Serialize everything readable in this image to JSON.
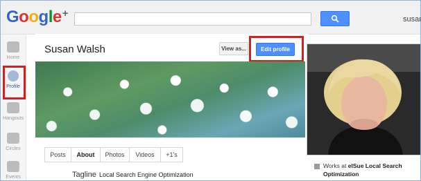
{
  "header": {
    "logo_parts": [
      "G",
      "o",
      "o",
      "g",
      "l",
      "e"
    ],
    "logo_plus": "+",
    "search_placeholder": "",
    "user_name": "susan"
  },
  "leftnav": {
    "items": [
      {
        "label": "Home",
        "icon": "home-icon"
      },
      {
        "label": "Profile",
        "icon": "profile-icon"
      },
      {
        "label": "Hangouts",
        "icon": "hangouts-icon"
      },
      {
        "label": "Circles",
        "icon": "circles-icon"
      },
      {
        "label": "Events",
        "icon": "events-icon"
      }
    ]
  },
  "profile": {
    "name": "Susan Walsh",
    "view_as_label": "View as...",
    "edit_profile_label": "Edit profile",
    "tabs": [
      "Posts",
      "About",
      "Photos",
      "Videos",
      "+1's"
    ],
    "active_tab": "About",
    "tagline_label": "Tagline",
    "tagline_value": "Local Search Engine Optimization",
    "works_at_prefix": "Works at ",
    "works_at_company": "elSue Local Search Optimization"
  },
  "colors": {
    "highlight": "#d21f1f",
    "accent_blue": "#4d90fe"
  }
}
